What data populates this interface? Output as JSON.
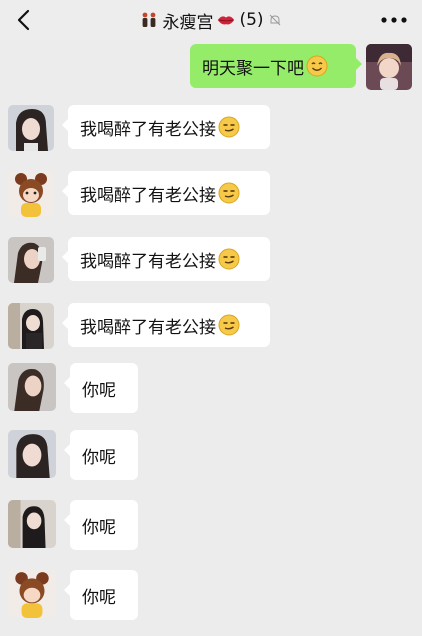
{
  "header": {
    "title": "永瘦宫",
    "member_count": "(5)",
    "back_icon": "chevron-left-icon",
    "more_icon": "ellipsis-icon",
    "title_icon": "couple-icon",
    "lips_icon": "lips-icon",
    "mute_icon": "bell-muted-icon"
  },
  "messages": [
    {
      "sender": "self",
      "text": "明天聚一下吧",
      "emoji": "smile-emoji"
    },
    {
      "sender": "member1",
      "text": "我喝醉了有老公接",
      "emoji": "smirk-emoji"
    },
    {
      "sender": "member2",
      "text": "我喝醉了有老公接",
      "emoji": "smirk-emoji"
    },
    {
      "sender": "member3",
      "text": "我喝醉了有老公接",
      "emoji": "smirk-emoji"
    },
    {
      "sender": "member4",
      "text": "我喝醉了有老公接",
      "emoji": "smirk-emoji"
    },
    {
      "sender": "member3",
      "text": "你呢"
    },
    {
      "sender": "member1",
      "text": "你呢"
    },
    {
      "sender": "member4",
      "text": "你呢"
    },
    {
      "sender": "member2",
      "text": "你呢"
    }
  ],
  "colors": {
    "background": "#ececec",
    "self_bubble": "#95ec69",
    "other_bubble": "#ffffff"
  }
}
